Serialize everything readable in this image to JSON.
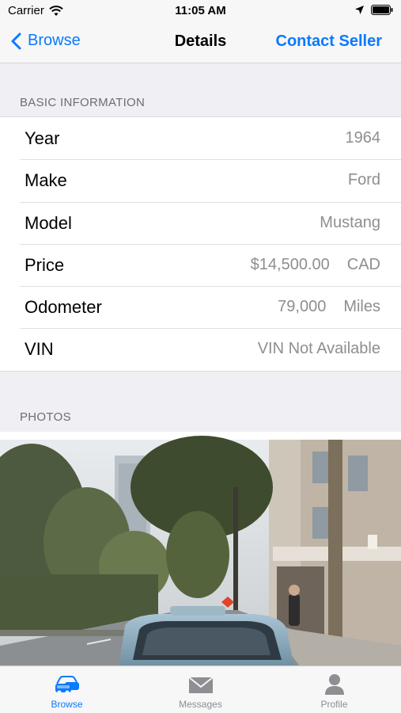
{
  "status_bar": {
    "carrier": "Carrier",
    "time": "11:05 AM"
  },
  "nav": {
    "back_label": "Browse",
    "title": "Details",
    "action_label": "Contact Seller"
  },
  "basic_info": {
    "header": "BASIC INFORMATION",
    "rows": [
      {
        "label": "Year",
        "value": "1964",
        "unit": ""
      },
      {
        "label": "Make",
        "value": "Ford",
        "unit": ""
      },
      {
        "label": "Model",
        "value": "Mustang",
        "unit": ""
      },
      {
        "label": "Price",
        "value": "$14,500.00",
        "unit": "CAD"
      },
      {
        "label": "Odometer",
        "value": "79,000",
        "unit": "Miles"
      },
      {
        "label": "VIN",
        "value": "VIN Not Available",
        "unit": ""
      }
    ]
  },
  "photos": {
    "header": "PHOTOS"
  },
  "tab_bar": {
    "tabs": [
      {
        "label": "Browse",
        "icon": "car-icon",
        "active": true
      },
      {
        "label": "Messages",
        "icon": "envelope-icon",
        "active": false
      },
      {
        "label": "Profile",
        "icon": "person-icon",
        "active": false
      }
    ]
  },
  "colors": {
    "accent": "#0a7aff",
    "secondary_text": "#8e8e93",
    "background": "#efeff4"
  }
}
